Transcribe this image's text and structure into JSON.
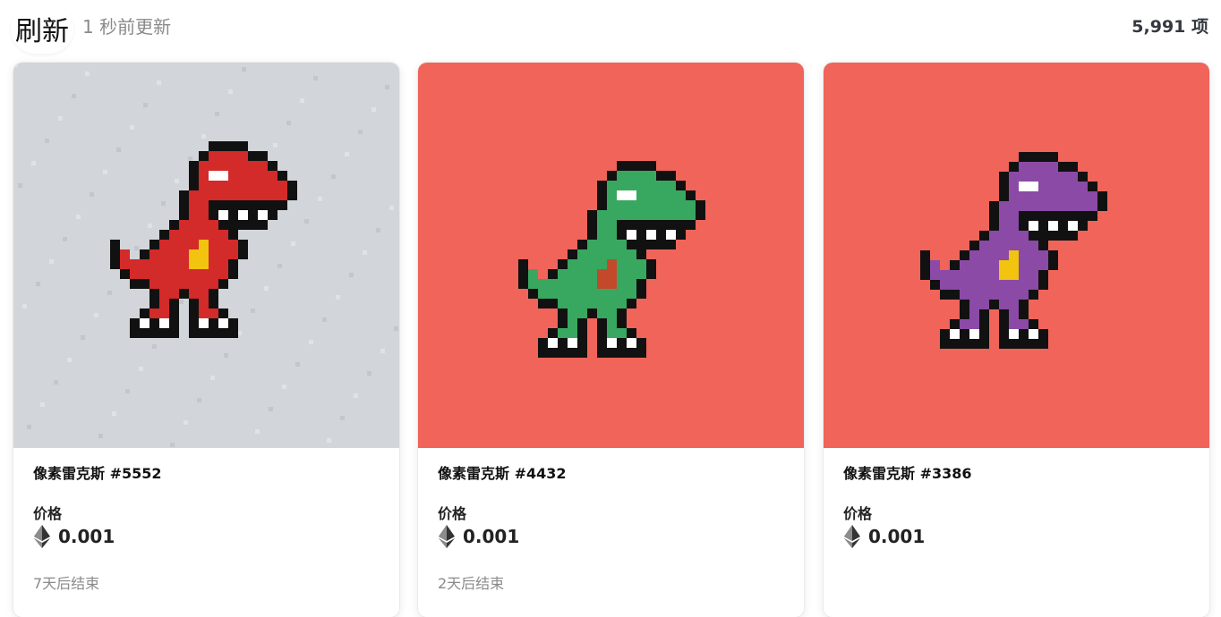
{
  "header": {
    "refresh_label": "刷新",
    "updated_text": "1 秒前更新",
    "item_count": "5,991 项"
  },
  "currency_icon": "ethereum-icon",
  "cards": [
    {
      "name": "像素雷克斯 #5552",
      "price_label": "价格",
      "price": "0.001",
      "ends": "7天后结束",
      "background": "#d2d5d9",
      "dino_color": "#d32a2a",
      "accent_color": "#f2c30f"
    },
    {
      "name": "像素雷克斯 #4432",
      "price_label": "价格",
      "price": "0.001",
      "ends": "2天后结束",
      "background": "#f0645a",
      "dino_color": "#38a860",
      "accent_color": "#c24a2a"
    },
    {
      "name": "像素雷克斯 #3386",
      "price_label": "价格",
      "price": "0.001",
      "ends": "",
      "background": "#f0645a",
      "dino_color": "#8b4aa6",
      "accent_color": "#f2c30f"
    }
  ]
}
